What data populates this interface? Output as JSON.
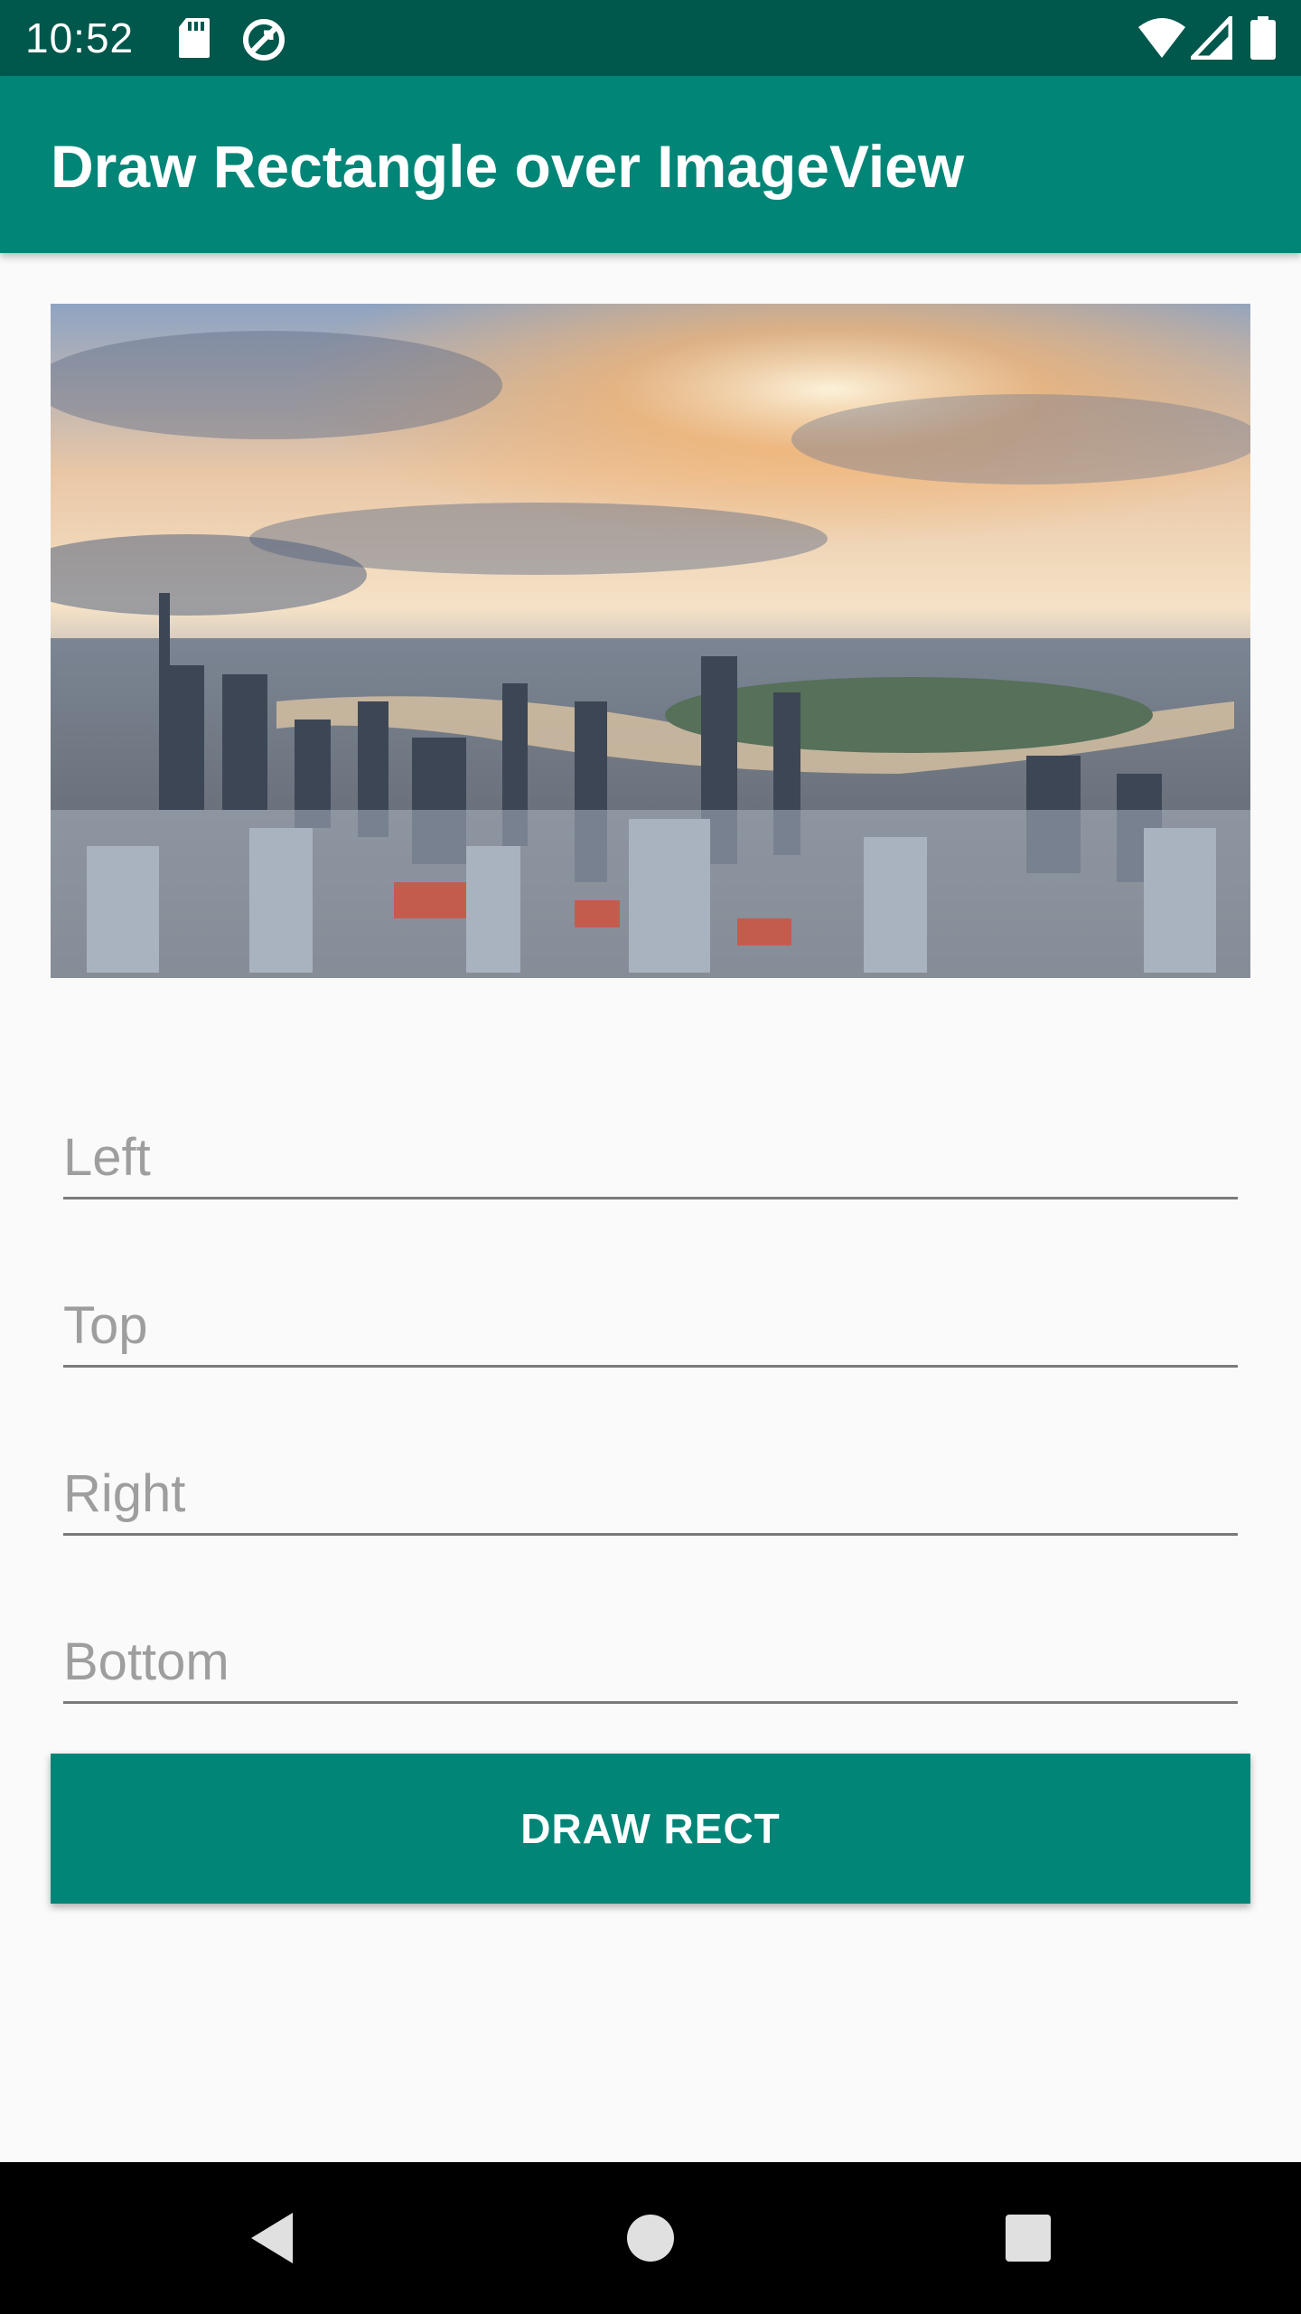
{
  "status_bar": {
    "time": "10:52",
    "icons": [
      "sd-card-icon",
      "sync-icon",
      "wifi-icon",
      "signal-icon",
      "battery-icon"
    ],
    "background": "#00574b"
  },
  "app_bar": {
    "title": "Draw Rectangle over ImageView",
    "color": "#008577"
  },
  "image_view": {
    "description_icon": "city-skyline-image"
  },
  "fields": [
    {
      "placeholder": "Left",
      "value": ""
    },
    {
      "placeholder": "Top",
      "value": ""
    },
    {
      "placeholder": "Right",
      "value": ""
    },
    {
      "placeholder": "Bottom",
      "value": ""
    }
  ],
  "button": {
    "label": "DRAW RECT",
    "color": "#008577"
  },
  "nav_bar": {
    "icons": [
      "back-icon",
      "home-icon",
      "recents-icon"
    ]
  }
}
